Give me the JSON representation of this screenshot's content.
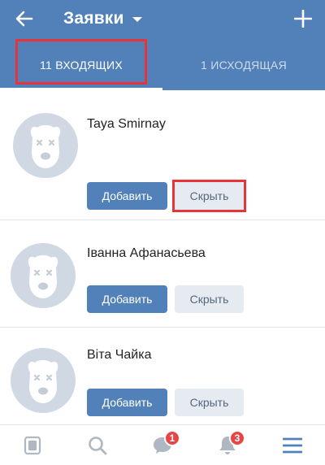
{
  "header": {
    "title": "Заявки",
    "tabs": [
      {
        "label": "11 ВХОДЯЩИХ",
        "active": true
      },
      {
        "label": "1 ИСХОДЯЩАЯ",
        "active": false
      }
    ]
  },
  "requests": [
    {
      "name": "Taya Smirnay",
      "add_label": "Добавить",
      "hide_label": "Скрыть"
    },
    {
      "name": "Іванна Афанасьева",
      "add_label": "Добавить",
      "hide_label": "Скрыть"
    },
    {
      "name": "Віта Чайка",
      "add_label": "Добавить",
      "hide_label": "Скрыть"
    }
  ],
  "bottom_nav": {
    "items": [
      {
        "icon": "news-icon"
      },
      {
        "icon": "search-icon"
      },
      {
        "icon": "messages-icon",
        "badge": "1"
      },
      {
        "icon": "notifications-icon",
        "badge": "3"
      },
      {
        "icon": "menu-icon"
      }
    ]
  },
  "colors": {
    "header": "#5181b8",
    "primary_button": "#5181b8",
    "secondary_button": "#e5ebf1",
    "highlight": "#e8333b",
    "badge": "#e64646",
    "nav_icon": "#aeb7c2",
    "nav_icon_active": "#5181b8"
  }
}
